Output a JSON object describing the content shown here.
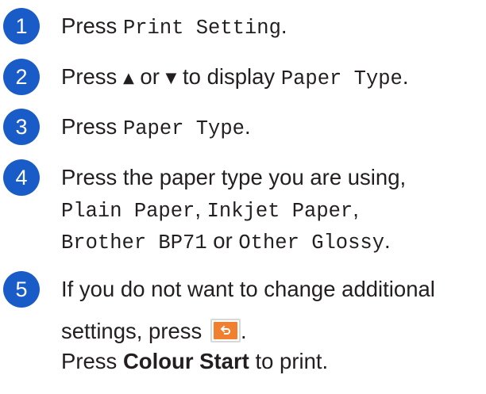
{
  "steps": [
    {
      "number": "1",
      "line1": {
        "prefix": "Press ",
        "code": "Print Setting",
        "suffix": "."
      }
    },
    {
      "number": "2",
      "line1": {
        "prefix": "Press ",
        "up_arrow": "▲",
        "or": " or ",
        "down_arrow": "▼",
        "middle": " to display ",
        "code": "Paper Type",
        "suffix": "."
      }
    },
    {
      "number": "3",
      "line1": {
        "prefix": "Press ",
        "code": "Paper Type",
        "suffix": "."
      }
    },
    {
      "number": "4",
      "line1": "Press the paper type you are using,",
      "line2": {
        "code1": "Plain Paper",
        "sep1": ", ",
        "code2": "Inkjet Paper",
        "sep2": ","
      },
      "line3": {
        "code1": "Brother BP71",
        "or": " or ",
        "code2": "Other Glossy",
        "suffix": "."
      }
    },
    {
      "number": "5",
      "line1": "If you do not want to change additional",
      "line2": {
        "prefix": "settings, press ",
        "button_icon": "back-arrow-icon",
        "suffix": "."
      },
      "line3": {
        "prefix": "Press ",
        "bold": "Colour Start",
        "suffix": " to print."
      }
    }
  ],
  "colors": {
    "step_circle": "#1a5cc7",
    "button_fill": "#f08030",
    "text": "#231f20"
  }
}
